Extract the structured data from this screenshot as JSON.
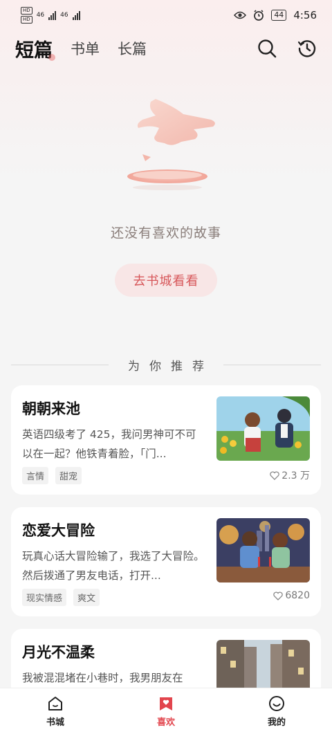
{
  "status_bar": {
    "time": "4:56",
    "battery": "44",
    "net1": "46",
    "net2": "46"
  },
  "header": {
    "tabs": [
      {
        "label": "短篇",
        "active": true
      },
      {
        "label": "书单",
        "active": false
      },
      {
        "label": "长篇",
        "active": false
      }
    ],
    "icons": [
      "search-icon",
      "history-icon"
    ]
  },
  "empty_state": {
    "message": "还没有喜欢的故事",
    "button_label": "去书城看看"
  },
  "recommend": {
    "title": "为你推荐",
    "items": [
      {
        "title": "朝朝来池",
        "desc": "英语四级考了 425，我问男神可不可以在一起？他铁青着脸，「门...",
        "tags": [
          "言情",
          "甜宠"
        ],
        "likes": "2.3 万"
      },
      {
        "title": "恋爱大冒险",
        "desc": "玩真心话大冒险输了，我选了大冒险。然后拨通了男友电话，打开...",
        "tags": [
          "现实情感",
          "爽文"
        ],
        "likes": "6820"
      },
      {
        "title": "月光不温柔",
        "desc": "我被混混堵在小巷时，我男朋友在",
        "tags": [],
        "likes": ""
      }
    ]
  },
  "bottom_nav": [
    {
      "label": "书城",
      "icon": "home-icon",
      "active": false
    },
    {
      "label": "喜欢",
      "icon": "bookmark-heart-icon",
      "active": true
    },
    {
      "label": "我的",
      "icon": "smile-icon",
      "active": false
    }
  ],
  "colors": {
    "accent": "#e2454d",
    "button_bg": "#f8e6e6"
  }
}
